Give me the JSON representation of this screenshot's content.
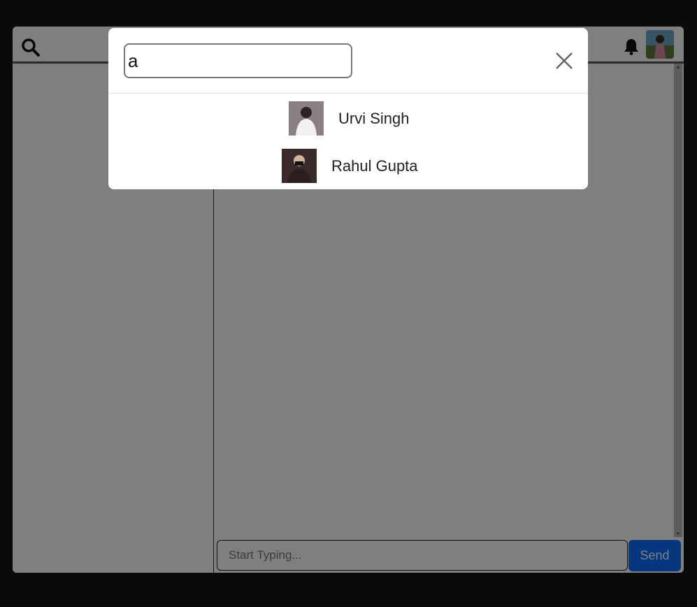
{
  "header": {
    "search_icon": "search-icon",
    "notification_icon": "bell-icon",
    "profile_icon": "avatar"
  },
  "composer": {
    "placeholder": "Start Typing...",
    "send_label": "Send"
  },
  "search_modal": {
    "query": "a",
    "close_icon": "close-icon",
    "results": [
      {
        "name": "Urvi Singh"
      },
      {
        "name": "Rahul Gupta"
      }
    ]
  },
  "colors": {
    "send_button": "#0d6efd",
    "backdrop": "#141414"
  }
}
